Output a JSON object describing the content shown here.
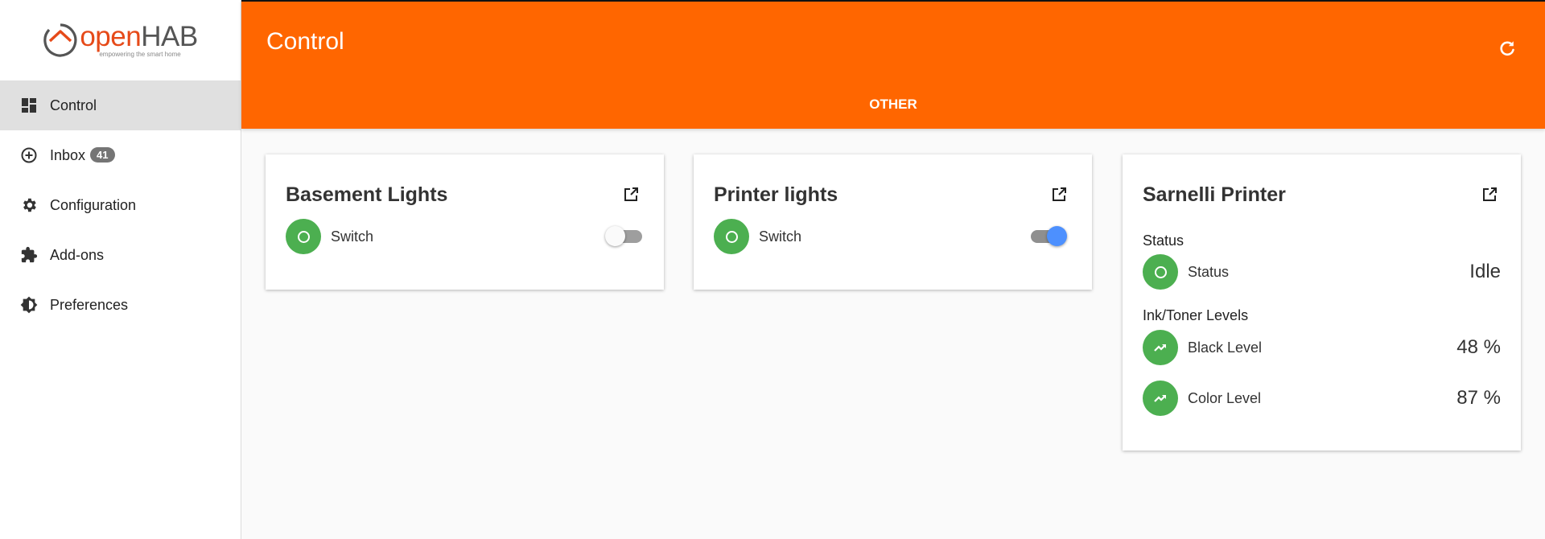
{
  "app": {
    "logo_open": "open",
    "logo_hab": "HAB",
    "logo_tagline": "empowering the smart home"
  },
  "sidebar": {
    "items": [
      {
        "label": "Control",
        "icon": "dashboard-icon",
        "active": true
      },
      {
        "label": "Inbox",
        "icon": "add-circle-icon",
        "badge": "41"
      },
      {
        "label": "Configuration",
        "icon": "gear-icon"
      },
      {
        "label": "Add-ons",
        "icon": "puzzle-icon"
      },
      {
        "label": "Preferences",
        "icon": "brightness-icon"
      }
    ]
  },
  "header": {
    "title": "Control",
    "tab": "OTHER",
    "refresh_icon": "refresh-icon"
  },
  "cards": [
    {
      "title": "Basement Lights",
      "items": [
        {
          "label": "Switch",
          "type": "switch",
          "state": "off"
        }
      ]
    },
    {
      "title": "Printer lights",
      "items": [
        {
          "label": "Switch",
          "type": "switch",
          "state": "on"
        }
      ]
    },
    {
      "title": "Sarnelli Printer",
      "sections": [
        {
          "label": "Status",
          "items": [
            {
              "label": "Status",
              "value": "Idle"
            }
          ]
        },
        {
          "label": "Ink/Toner Levels",
          "items": [
            {
              "label": "Black Level",
              "value": "48 %"
            },
            {
              "label": "Color Level",
              "value": "87 %"
            }
          ]
        }
      ]
    }
  ],
  "colors": {
    "accent": "#ff6600",
    "item_circle": "#4caf50",
    "toggle_on": "#4d90fe",
    "active_nav": "#e0e0e0"
  }
}
